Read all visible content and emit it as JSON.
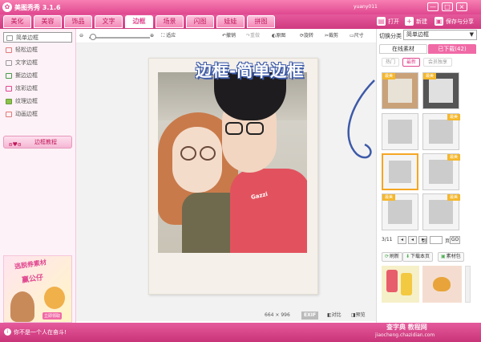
{
  "app": {
    "title": "美图秀秀 3.1.6",
    "user": "yuany011",
    "controls": [
      "—",
      "□",
      "×"
    ]
  },
  "tabs": [
    "美化",
    "美容",
    "饰品",
    "文字",
    "边框",
    "场景",
    "闪图",
    "娃娃",
    "拼图"
  ],
  "top_actions": {
    "open": "打开",
    "new": "新建",
    "save": "保存与分享"
  },
  "sidebar": {
    "items": [
      "简单边框",
      "轻松边框",
      "文字边框",
      "撕边边框",
      "炫彩边框",
      "纹理边框",
      "动画边框"
    ],
    "tutorial": "边框教程",
    "ad": {
      "line1": "逃脱券素材",
      "line2": "赢公仔",
      "badge": "立即领取"
    }
  },
  "toolbar": {
    "fit": "适应",
    "undo": "撤销",
    "redo": "重做",
    "original": "原图",
    "rotate": "旋转",
    "crop": "裁剪",
    "size": "尺寸"
  },
  "canvas": {
    "overlay": "边框-简单边框",
    "shirt_text": "Gazzi",
    "dims_w": "664",
    "dims_x": "×",
    "dims_h": "996",
    "exif": "EXIF",
    "compare": "对比",
    "preview": "预览"
  },
  "right": {
    "category_label": "切换分类",
    "category_value": "简单边框",
    "tabs": [
      "在线素材",
      "已下载(42)"
    ],
    "subtabs": [
      "热门",
      "最新",
      "会员独享"
    ],
    "thumb_tag": "最美",
    "pager": {
      "current": "3/11",
      "goto": "到",
      "page": "页",
      "go": "GO"
    },
    "actions": [
      "刷新",
      "下载本页",
      "素材包"
    ]
  },
  "status": {
    "text": "你不是一个人在奋斗!"
  },
  "watermark": {
    "line1": "查字典 教程网",
    "line2": "jiaocheng.chazidian.com"
  }
}
